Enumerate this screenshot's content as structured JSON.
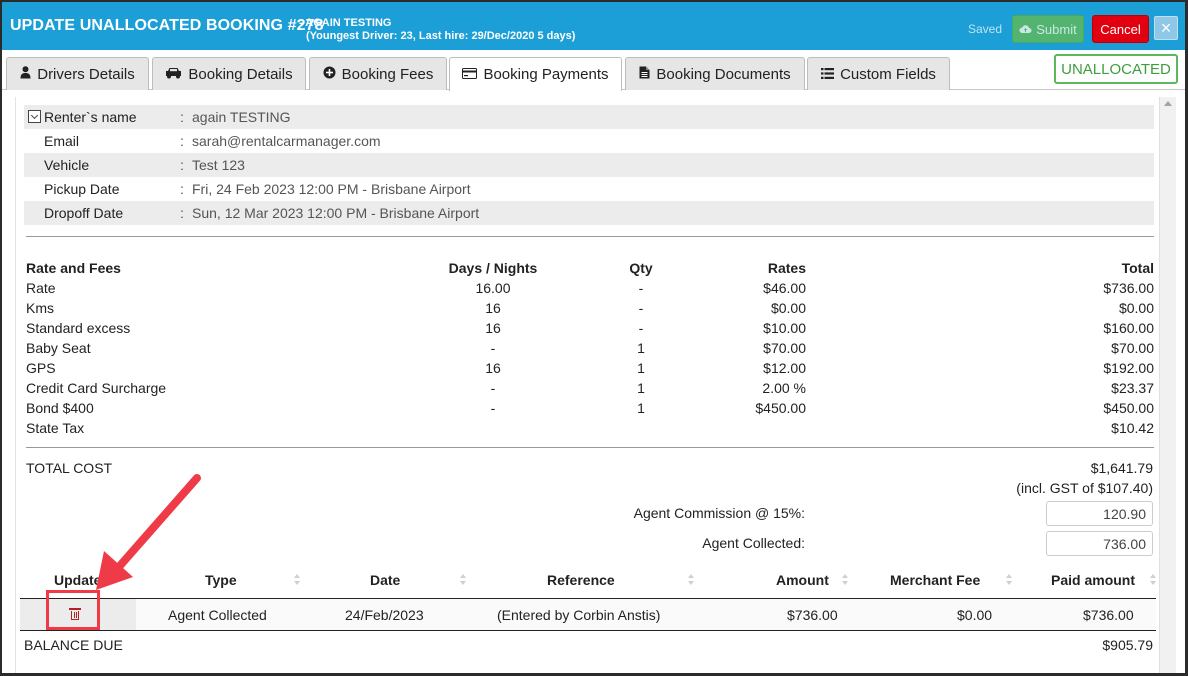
{
  "header": {
    "title": "UPDATE UNALLOCATED BOOKING #278",
    "subtitle_line1": "- AGAIN TESTING",
    "subtitle_line2": "(Youngest Driver: 23, Last hire: 29/Dec/2020 5 days)",
    "saved_label": "Saved",
    "submit_label": "Submit",
    "cancel_label": "Cancel",
    "close_label": "×",
    "colors": {
      "header_bg": "#1c9fd6",
      "submit": "#5cb85c",
      "cancel": "#e0000f",
      "status": "#5cb85c"
    }
  },
  "tabs": [
    {
      "label": "Drivers Details",
      "icon": "user-icon"
    },
    {
      "label": "Booking Details",
      "icon": "car-icon"
    },
    {
      "label": "Booking Fees",
      "icon": "plus-circle-icon"
    },
    {
      "label": "Booking Payments",
      "icon": "credit-card-icon",
      "active": true
    },
    {
      "label": "Booking Documents",
      "icon": "document-icon"
    },
    {
      "label": "Custom Fields",
      "icon": "list-icon"
    }
  ],
  "status_badge": "UNALLOCATED",
  "renter": {
    "rows": [
      {
        "label": "Renter`s name",
        "value": "again TESTING"
      },
      {
        "label": "Email",
        "value": "sarah@rentalcarmanager.com"
      },
      {
        "label": "Vehicle",
        "value": "Test 123"
      },
      {
        "label": "Pickup Date",
        "value": "Fri, 24 Feb 2023 12:00 PM - Brisbane Airport"
      },
      {
        "label": "Dropoff Date",
        "value": "Sun, 12 Mar 2023 12:00 PM - Brisbane Airport"
      }
    ],
    "colon": ":"
  },
  "fees": {
    "headers": {
      "name": "Rate and Fees",
      "days": "Days / Nights",
      "qty": "Qty",
      "rates": "Rates",
      "total": "Total"
    },
    "rows": [
      {
        "name": "Rate",
        "days": "16.00",
        "qty": "-",
        "rate": "$46.00",
        "total": "$736.00"
      },
      {
        "name": "Kms",
        "days": "16",
        "qty": "-",
        "rate": "$0.00",
        "total": "$0.00"
      },
      {
        "name": "Standard excess",
        "days": "16",
        "qty": "-",
        "rate": "$10.00",
        "total": "$160.00"
      },
      {
        "name": "Baby Seat",
        "days": "-",
        "qty": "1",
        "rate": "$70.00",
        "total": "$70.00"
      },
      {
        "name": "GPS",
        "days": "16",
        "qty": "1",
        "rate": "$12.00",
        "total": "$192.00"
      },
      {
        "name": "Credit Card Surcharge",
        "days": "-",
        "qty": "1",
        "rate": "2.00 %",
        "total": "$23.37"
      },
      {
        "name": "Bond $400",
        "days": "-",
        "qty": "1",
        "rate": "$450.00",
        "total": "$450.00"
      },
      {
        "name": "State Tax",
        "days": "",
        "qty": "",
        "rate": "",
        "total": "$10.42"
      }
    ]
  },
  "totals": {
    "total_label": "TOTAL COST",
    "total_value": "$1,641.79",
    "gst_note": "(incl. GST of $107.40)",
    "commission_label": "Agent Commission @ 15%:",
    "commission_value": "120.90",
    "collected_label": "Agent Collected:",
    "collected_value": "736.00"
  },
  "payments": {
    "headers": {
      "update": "Update",
      "type": "Type",
      "date": "Date",
      "reference": "Reference",
      "amount": "Amount",
      "merchant_fee": "Merchant Fee",
      "paid_amount": "Paid amount"
    },
    "rows": [
      {
        "type": "Agent Collected",
        "date": "24/Feb/2023",
        "reference": "(Entered by Corbin Anstis)",
        "amount": "$736.00",
        "merchant_fee": "$0.00",
        "paid_amount": "$736.00"
      }
    ]
  },
  "balance": {
    "label": "BALANCE DUE",
    "value": "$905.79"
  }
}
